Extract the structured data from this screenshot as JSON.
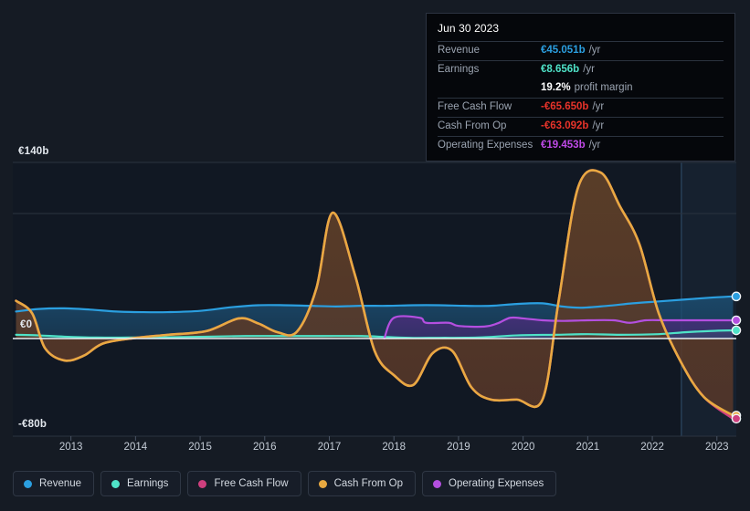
{
  "background_color": "#151b24",
  "tooltip": {
    "date": "Jun 30 2023",
    "rows": [
      {
        "label": "Revenue",
        "value": "€45.051b",
        "unit": "/yr",
        "color": "#2b9fe0"
      },
      {
        "label": "Earnings",
        "value": "€8.656b",
        "unit": "/yr",
        "color": "#4fe3c8"
      },
      {
        "label": "",
        "value": "19.2%",
        "unit": "profit margin",
        "color": "#ffffff"
      },
      {
        "label": "Free Cash Flow",
        "value": "-€65.650b",
        "unit": "/yr",
        "color": "#e8332a"
      },
      {
        "label": "Cash From Op",
        "value": "-€63.092b",
        "unit": "/yr",
        "color": "#e8332a"
      },
      {
        "label": "Operating Expenses",
        "value": "€19.453b",
        "unit": "/yr",
        "color": "#c04ae8"
      }
    ]
  },
  "legend": {
    "items": [
      {
        "label": "Revenue",
        "color": "#2b9fe0"
      },
      {
        "label": "Earnings",
        "color": "#4fe3c8"
      },
      {
        "label": "Free Cash Flow",
        "color": "#cf3f7e"
      },
      {
        "label": "Cash From Op",
        "color": "#e8a941"
      },
      {
        "label": "Operating Expenses",
        "color": "#b44fe0"
      }
    ]
  },
  "chart_data": {
    "type": "area",
    "title": "",
    "xlabel": "",
    "ylabel": "",
    "grid": true,
    "legend_position": "bottom",
    "currency": "EUR",
    "units": "billions",
    "ylim": [
      -80,
      140
    ],
    "y_ticks": [
      {
        "value": 140,
        "label": "€140b"
      },
      {
        "value": 0,
        "label": "€0"
      },
      {
        "value": -80,
        "label": "-€80b"
      }
    ],
    "x_tick_labels": [
      "2013",
      "2014",
      "2015",
      "2016",
      "2017",
      "2018",
      "2019",
      "2020",
      "2021",
      "2022",
      "2023"
    ],
    "xlim": [
      2012.6,
      2023.8
    ],
    "forecast_start": 2022.95,
    "forecast_end": 2023.8,
    "series": [
      {
        "name": "Revenue",
        "color": "#2b9fe0",
        "fill": "#1c4e72",
        "x": [
          2012.65,
          2013.0,
          2013.4,
          2013.8,
          2014.2,
          2014.6,
          2015.0,
          2015.5,
          2016.0,
          2016.4,
          2016.8,
          2017.2,
          2017.6,
          2018.0,
          2018.4,
          2018.8,
          2019.2,
          2019.6,
          2020.0,
          2020.4,
          2020.8,
          2021.1,
          2021.4,
          2021.8,
          2022.2,
          2022.6,
          2023.0,
          2023.4,
          2023.75
        ],
        "y": [
          21.5,
          23.5,
          24.0,
          23.0,
          21.5,
          21.0,
          21.0,
          22.0,
          25.0,
          26.5,
          26.5,
          26.0,
          25.5,
          26.0,
          26.0,
          26.5,
          26.5,
          26.0,
          26.0,
          27.5,
          28.0,
          25.5,
          24.5,
          26.0,
          28.0,
          29.5,
          31.0,
          32.5,
          33.5
        ]
      },
      {
        "name": "Earnings",
        "color": "#4fe3c8",
        "fill": "#1f6b63",
        "x": [
          2012.65,
          2013.0,
          2013.4,
          2013.9,
          2014.4,
          2015.0,
          2015.6,
          2016.2,
          2016.8,
          2017.4,
          2018.0,
          2018.4,
          2018.8,
          2019.2,
          2019.8,
          2020.4,
          2021.0,
          2021.5,
          2022.0,
          2022.6,
          2023.0,
          2023.4,
          2023.75
        ],
        "y": [
          3.0,
          2.5,
          1.5,
          0.8,
          0.8,
          1.0,
          1.5,
          2.0,
          2.0,
          2.0,
          2.0,
          1.2,
          0.5,
          0.6,
          0.8,
          2.5,
          3.0,
          3.5,
          3.0,
          3.5,
          5.0,
          6.0,
          6.5
        ]
      },
      {
        "name": "Operating Expenses",
        "color": "#b44fe0",
        "fill": "#4a2c7a",
        "x": [
          2018.35,
          2018.5,
          2018.9,
          2019.0,
          2019.35,
          2019.5,
          2019.9,
          2020.1,
          2020.3,
          2020.5,
          2020.8,
          2021.1,
          2021.5,
          2021.9,
          2022.15,
          2022.4,
          2022.7,
          2023.0,
          2023.4,
          2023.75
        ],
        "y": [
          0.0,
          16.5,
          16.5,
          12.5,
          12.5,
          10.0,
          9.5,
          12.0,
          16.5,
          16.0,
          14.5,
          14.0,
          14.5,
          14.5,
          12.5,
          14.5,
          14.5,
          14.5,
          14.5,
          14.5
        ]
      },
      {
        "name": "Free Cash Flow",
        "color": "#cf3f7e",
        "fill": "#5a2029",
        "x": [
          2012.65,
          2012.9,
          2013.1,
          2013.4,
          2013.7,
          2014.0,
          2014.5,
          2015.0,
          2015.6,
          2016.1,
          2016.4,
          2016.7,
          2017.0,
          2017.3,
          2017.55,
          2017.9,
          2018.2,
          2018.5,
          2018.8,
          2019.1,
          2019.4,
          2019.7,
          2020.0,
          2020.4,
          2020.8,
          2021.05,
          2021.35,
          2021.7,
          2022.0,
          2022.3,
          2022.6,
          2022.95,
          2023.3,
          2023.75
        ],
        "y": [
          30.0,
          20.0,
          -8.0,
          -18.0,
          -14.0,
          -4.0,
          0.5,
          3.0,
          6.0,
          16.0,
          12.0,
          5.0,
          5.5,
          40.0,
          100.0,
          50.0,
          -10.0,
          -30.0,
          -38.0,
          -12.0,
          -10.0,
          -40.0,
          -50.0,
          -50.0,
          -50.0,
          30.0,
          120.0,
          132.0,
          105.0,
          75.0,
          20.0,
          -20.0,
          -48.0,
          -65.65
        ]
      },
      {
        "name": "Cash From Op",
        "color": "#e8a941",
        "fill": "#5a4328",
        "x": [
          2012.65,
          2012.9,
          2013.1,
          2013.4,
          2013.7,
          2014.0,
          2014.5,
          2015.0,
          2015.6,
          2016.1,
          2016.4,
          2016.7,
          2017.0,
          2017.3,
          2017.55,
          2017.9,
          2018.2,
          2018.5,
          2018.8,
          2019.1,
          2019.4,
          2019.7,
          2020.0,
          2020.4,
          2020.8,
          2021.05,
          2021.35,
          2021.7,
          2022.0,
          2022.3,
          2022.6,
          2022.95,
          2023.3,
          2023.75
        ],
        "y": [
          30.0,
          20.0,
          -8.0,
          -18.0,
          -14.0,
          -4.0,
          0.5,
          3.0,
          6.0,
          16.0,
          12.0,
          5.0,
          5.5,
          40.0,
          100.0,
          50.0,
          -10.0,
          -30.0,
          -38.0,
          -12.0,
          -10.0,
          -40.0,
          -50.0,
          -50.0,
          -50.0,
          30.0,
          120.0,
          132.0,
          105.0,
          75.0,
          20.0,
          -20.0,
          -48.0,
          -63.09
        ]
      }
    ],
    "end_markers": [
      {
        "name": "Revenue",
        "value": 33.5,
        "color": "#2b9fe0"
      },
      {
        "name": "Operating Expenses",
        "value": 14.5,
        "color": "#b44fe0"
      },
      {
        "name": "Earnings",
        "value": 6.5,
        "color": "#4fe3c8"
      },
      {
        "name": "Cash From Op",
        "value": -63.09,
        "color": "#e8a941"
      },
      {
        "name": "Free Cash Flow",
        "value": -65.65,
        "color": "#cf3f7e"
      }
    ]
  }
}
